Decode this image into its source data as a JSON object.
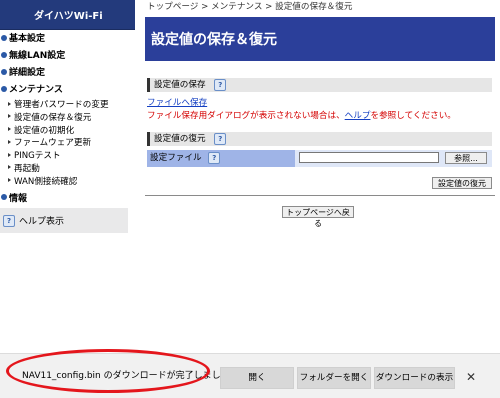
{
  "brand": "ダイハツWi-Fi",
  "nav": {
    "groups": [
      {
        "label": "基本設定"
      },
      {
        "label": "無線LAN設定"
      },
      {
        "label": "詳細設定"
      },
      {
        "label": "メンテナンス"
      }
    ],
    "maintenance_items": [
      "管理者パスワードの変更",
      "設定値の保存＆復元",
      "設定値の初期化",
      "ファームウェア更新",
      "PINGテスト",
      "再起動",
      "WAN側接続確認"
    ],
    "info": "情報",
    "help": "ヘルプ表示"
  },
  "breadcrumb": "トップページ > メンテナンス > 設定値の保存＆復元",
  "page_title": "設定値の保存＆復元",
  "save_section": {
    "label": "設定値の保存",
    "link": "ファイルへ保存",
    "error_prefix": "ファイル保存用ダイアログが表示されない場合は、",
    "error_link": "ヘルプ",
    "error_suffix": "を参照してください。"
  },
  "restore_section": {
    "label": "設定値の復元",
    "file_label": "設定ファイル",
    "browse": "参照...",
    "restore_button": "設定値の復元"
  },
  "back_button": "トップページへ戻る",
  "download_bar": {
    "message": "NAV11_config.bin のダウンロードが完了しまし",
    "open": "開く",
    "open_folder": "フォルダーを開く",
    "show_downloads": "ダウンロードの表示",
    "close": "✕"
  },
  "help_icon_glyph": "?",
  "colors": {
    "brand_bg": "#233a7c",
    "title_bg": "#2b3f9a",
    "link": "#1540c2",
    "error": "#d40000",
    "highlight_oval": "#e4161c"
  }
}
